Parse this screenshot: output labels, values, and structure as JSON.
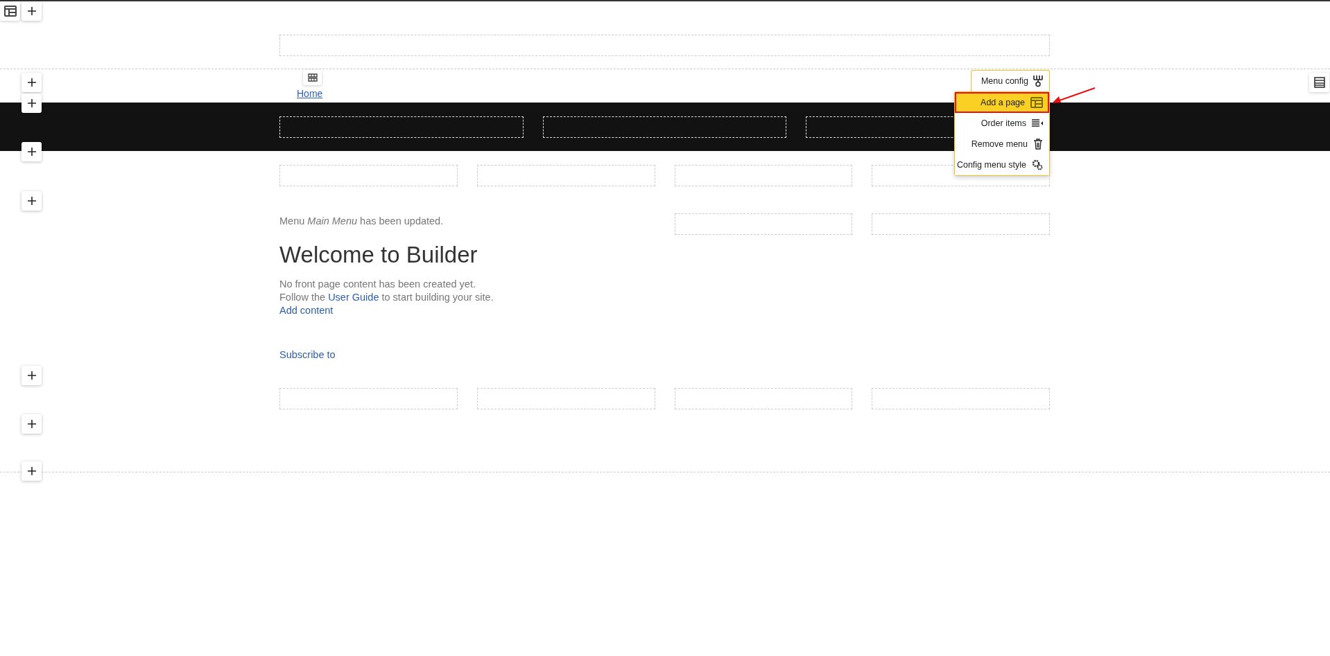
{
  "navigation": {
    "links": [
      {
        "label": "Home"
      }
    ]
  },
  "status_message": "Menu *Main Menu* has been updated.",
  "heading": "Welcome to Builder",
  "intro": {
    "line_1": "No front page content has been created yet.",
    "line_2_before": "Follow the ",
    "line_2_link": "User Guide",
    "line_2_after": " to start building your site.",
    "add_link": "Add content"
  },
  "subscribe_link": "Subscribe to",
  "menu_popup": {
    "title": "Menu config",
    "items": [
      {
        "label": "Add a page",
        "kind": "add-page",
        "selected": true
      },
      {
        "label": "Order items",
        "kind": "order",
        "selected": false
      },
      {
        "label": "Remove menu",
        "kind": "remove",
        "selected": false
      },
      {
        "label": "Config menu style",
        "kind": "style",
        "selected": false
      }
    ]
  }
}
